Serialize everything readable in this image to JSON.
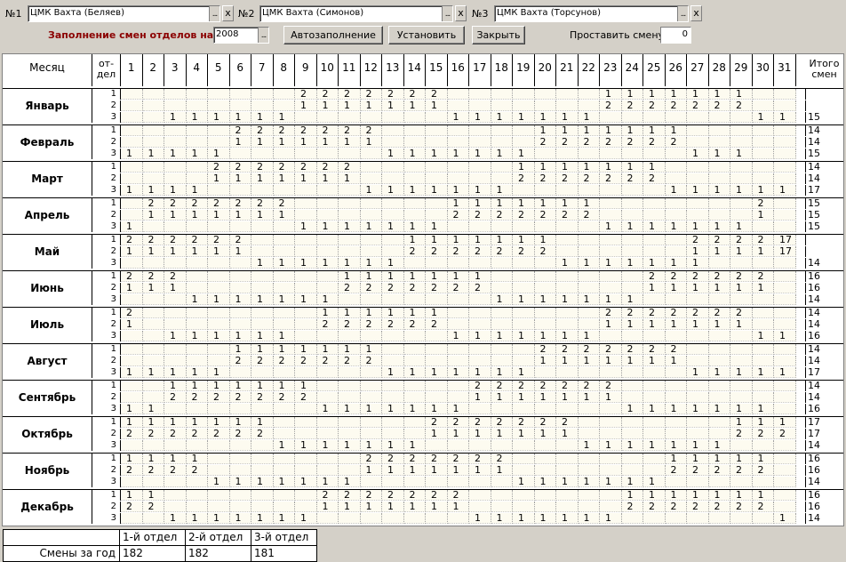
{
  "toolbar": {
    "slot1_label": "№1",
    "slot1_value": "ЦМК Вахта (Беляев)",
    "slot2_label": "№2",
    "slot2_value": "ЦМК Вахта (Симонов)",
    "slot3_label": "№3",
    "slot3_value": "ЦМК Вахта (Торсунов)",
    "clear_label": "x",
    "fill_label": "Заполнение смен отделов на",
    "year_value": "2008",
    "autofill_label": "Автозаполнение",
    "set_label": "Установить",
    "close_label": "Закрыть",
    "set_shift_label": "Проставить смену",
    "set_shift_value": "0",
    "accent_color": "#8b0000"
  },
  "header": {
    "month_label": "Месяц",
    "dept_label_1": "от-",
    "dept_label_2": "дел",
    "total_label_1": "Итого",
    "total_label_2": "смен",
    "days": [
      "1",
      "2",
      "3",
      "4",
      "5",
      "6",
      "7",
      "8",
      "9",
      "10",
      "11",
      "12",
      "13",
      "14",
      "15",
      "16",
      "17",
      "18",
      "19",
      "20",
      "21",
      "22",
      "23",
      "24",
      "25",
      "26",
      "27",
      "28",
      "29",
      "30",
      "31"
    ]
  },
  "months": [
    {
      "name": "Январь",
      "rows": [
        [
          "1",
          "",
          "",
          "",
          "",
          "",
          "",
          "",
          "",
          "",
          "",
          "",
          "",
          "",
          "",
          "",
          "",
          "",
          "",
          "",
          "",
          "",
          "",
          "1",
          "1",
          "1",
          "1",
          "1",
          "1",
          "1",
          "",
          "",
          ""
        ],
        [
          "2",
          "",
          "",
          "",
          "",
          "",
          "",
          "",
          "2",
          "2",
          "2",
          "2",
          "2",
          "2",
          "2",
          "",
          "",
          "",
          "",
          "",
          "",
          "",
          "2",
          "2",
          "2",
          "2",
          "2",
          "2",
          "2",
          "",
          "",
          ""
        ]
      ]
    }
  ]
}
